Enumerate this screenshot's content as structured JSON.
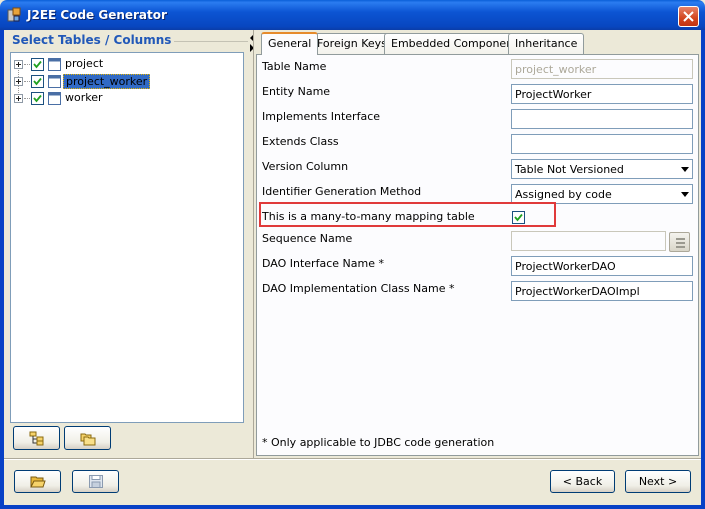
{
  "window": {
    "title": "J2EE Code Generator"
  },
  "left_panel": {
    "title": "Select Tables / Columns",
    "tree": [
      {
        "label": "project",
        "checked": true,
        "selected": false
      },
      {
        "label": "project_worker",
        "checked": true,
        "selected": true
      },
      {
        "label": "worker",
        "checked": true,
        "selected": false
      }
    ]
  },
  "tabs": [
    {
      "label": "General",
      "active": true
    },
    {
      "label": "Foreign Keys",
      "active": false
    },
    {
      "label": "Embedded Components",
      "active": false
    },
    {
      "label": "Inheritance",
      "active": false
    }
  ],
  "form": {
    "table_name_label": "Table Name",
    "table_name_value": "project_worker",
    "entity_name_label": "Entity Name",
    "entity_name_value": "ProjectWorker",
    "implements_label": "Implements Interface",
    "implements_value": "",
    "extends_label": "Extends Class",
    "extends_value": "",
    "version_column_label": "Version Column",
    "version_column_value": "Table Not Versioned",
    "id_generation_label": "Identifier Generation Method",
    "id_generation_value": "Assigned by code",
    "many_to_many_label": "This is a many-to-many mapping table",
    "many_to_many_checked": true,
    "sequence_name_label": "Sequence Name",
    "sequence_name_value": "",
    "dao_interface_label": "DAO Interface Name *",
    "dao_interface_value": "ProjectWorkerDAO",
    "dao_impl_label": "DAO Implementation Class Name *",
    "dao_impl_value": "ProjectWorkerDAOImpl",
    "footnote": "* Only applicable to JDBC code generation"
  },
  "buttons": {
    "back": "< Back",
    "next": "Next >"
  },
  "colors": {
    "titlebar": "#0a55d3",
    "highlight": "#e03a3a",
    "group_title": "#2158b8",
    "selection": "#316ac5"
  }
}
